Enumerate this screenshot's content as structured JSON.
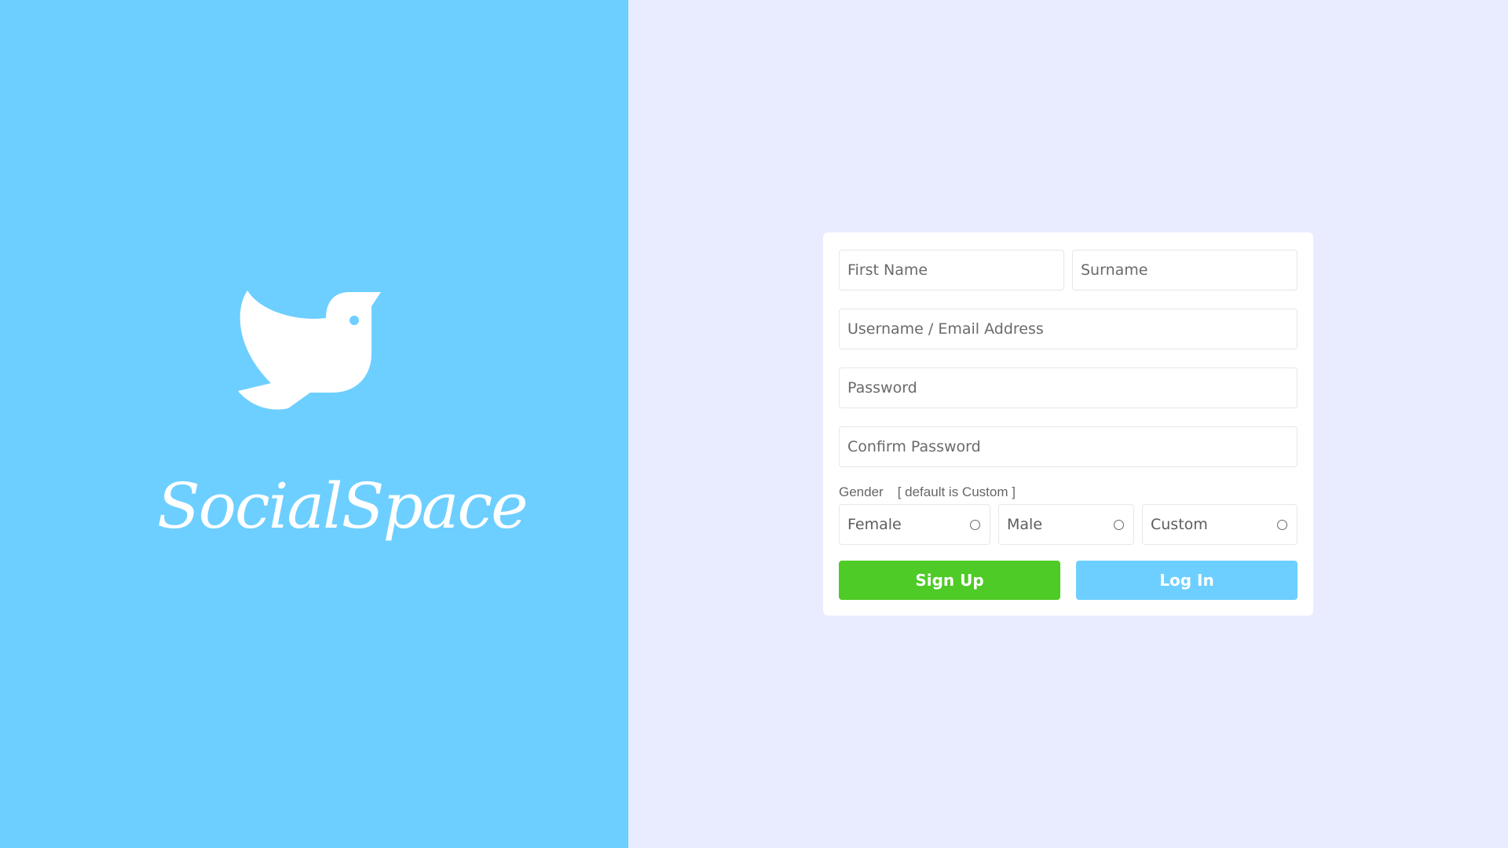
{
  "brand": {
    "name": "SocialSpace",
    "logo_icon": "dove-icon",
    "panel_color": "#6dcfff"
  },
  "form": {
    "first_name_placeholder": "First Name",
    "surname_placeholder": "Surname",
    "username_placeholder": "Username / Email Address",
    "password_placeholder": "Password",
    "confirm_password_placeholder": "Confirm Password",
    "gender_label": "Gender",
    "gender_hint": "[ default is Custom ]",
    "gender_options": [
      {
        "label": "Female"
      },
      {
        "label": "Male"
      },
      {
        "label": "Custom"
      }
    ],
    "signup_label": "Sign Up",
    "login_label": "Log In"
  },
  "colors": {
    "signup_button": "#4ecb26",
    "login_button": "#6dcfff",
    "form_background": "#e9ecff"
  }
}
